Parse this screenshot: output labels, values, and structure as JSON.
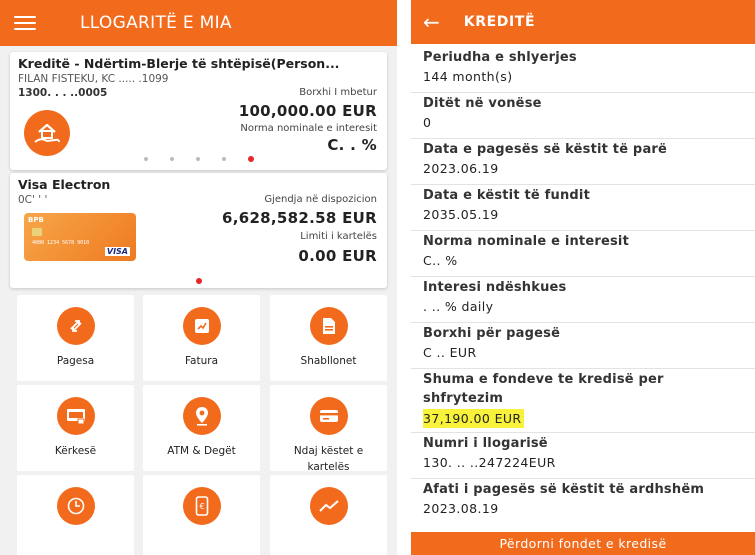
{
  "left": {
    "header": {
      "title": "LLOGARITË E MIA"
    },
    "loan_card": {
      "title": "Kreditë - Ndërtim-Blerje të shtëpisë(Person...",
      "owner": "FILAN FISTEKU, KC ..... .1099",
      "account": "1300.    .    .    ..0005",
      "debt_label": "Borxhi I mbetur",
      "debt_value": "100,000.00 EUR",
      "rate_label": "Norma nominale e interesit",
      "rate_value": "C.  .  %"
    },
    "visa_card": {
      "title": "Visa Electron",
      "account": "0C'    '    '",
      "balance_label": "Gjendja në dispozicion",
      "balance_value": "6,628,582.58 EUR",
      "limit_label": "Limiti i kartelës",
      "limit_value": "0.00 EUR",
      "card_brand": "BPB",
      "card_number": "4000 1234 5678 9010",
      "card_logo": "VISA"
    },
    "tiles": [
      {
        "label": "Pagesa",
        "icon": "transfer-icon"
      },
      {
        "label": "Fatura",
        "icon": "invoice-icon"
      },
      {
        "label": "Shabllonet",
        "icon": "document-icon"
      },
      {
        "label": "Kërkesë",
        "icon": "request-icon"
      },
      {
        "label": "ATM & Degët",
        "icon": "location-pin-icon"
      },
      {
        "label": "Ndaj këstet e kartelës",
        "icon": "card-icon"
      },
      {
        "label": "",
        "icon": "clock-icon"
      },
      {
        "label": "",
        "icon": "phone-euro-icon"
      },
      {
        "label": "",
        "icon": "trend-chart-icon"
      }
    ]
  },
  "right": {
    "header": {
      "title": "KREDITË"
    },
    "rows": [
      {
        "label": "Periudha e shlyerjes",
        "value": "144 month(s)"
      },
      {
        "label": "Ditët në vonëse",
        "value": "0"
      },
      {
        "label": "Data e pagesës së këstit të parë",
        "value": "2023.06.19"
      },
      {
        "label": "Data e këstit të fundit",
        "value": "2035.05.19"
      },
      {
        "label": "Norma nominale e interesit",
        "value": "C.. %"
      },
      {
        "label": "Interesi ndëshkues",
        "value": ". .. % daily"
      },
      {
        "label": "Borxhi për pagesë",
        "value": "C  .. EUR"
      },
      {
        "label": "Shuma e fondeve te kredisë per shfrytezim",
        "value": "37,190.00 EUR"
      },
      {
        "label": "Numri i llogarisë",
        "value": "130.        .. ..247224EUR"
      },
      {
        "label": "Afati i pagesës së këstit të ardhshëm",
        "value": "2023.08.19"
      }
    ],
    "button": "Përdorni fondet e kredisë"
  },
  "colors": {
    "accent": "#f26b1d",
    "highlight": "#f8f33a",
    "dot_active": "#e8262a"
  }
}
